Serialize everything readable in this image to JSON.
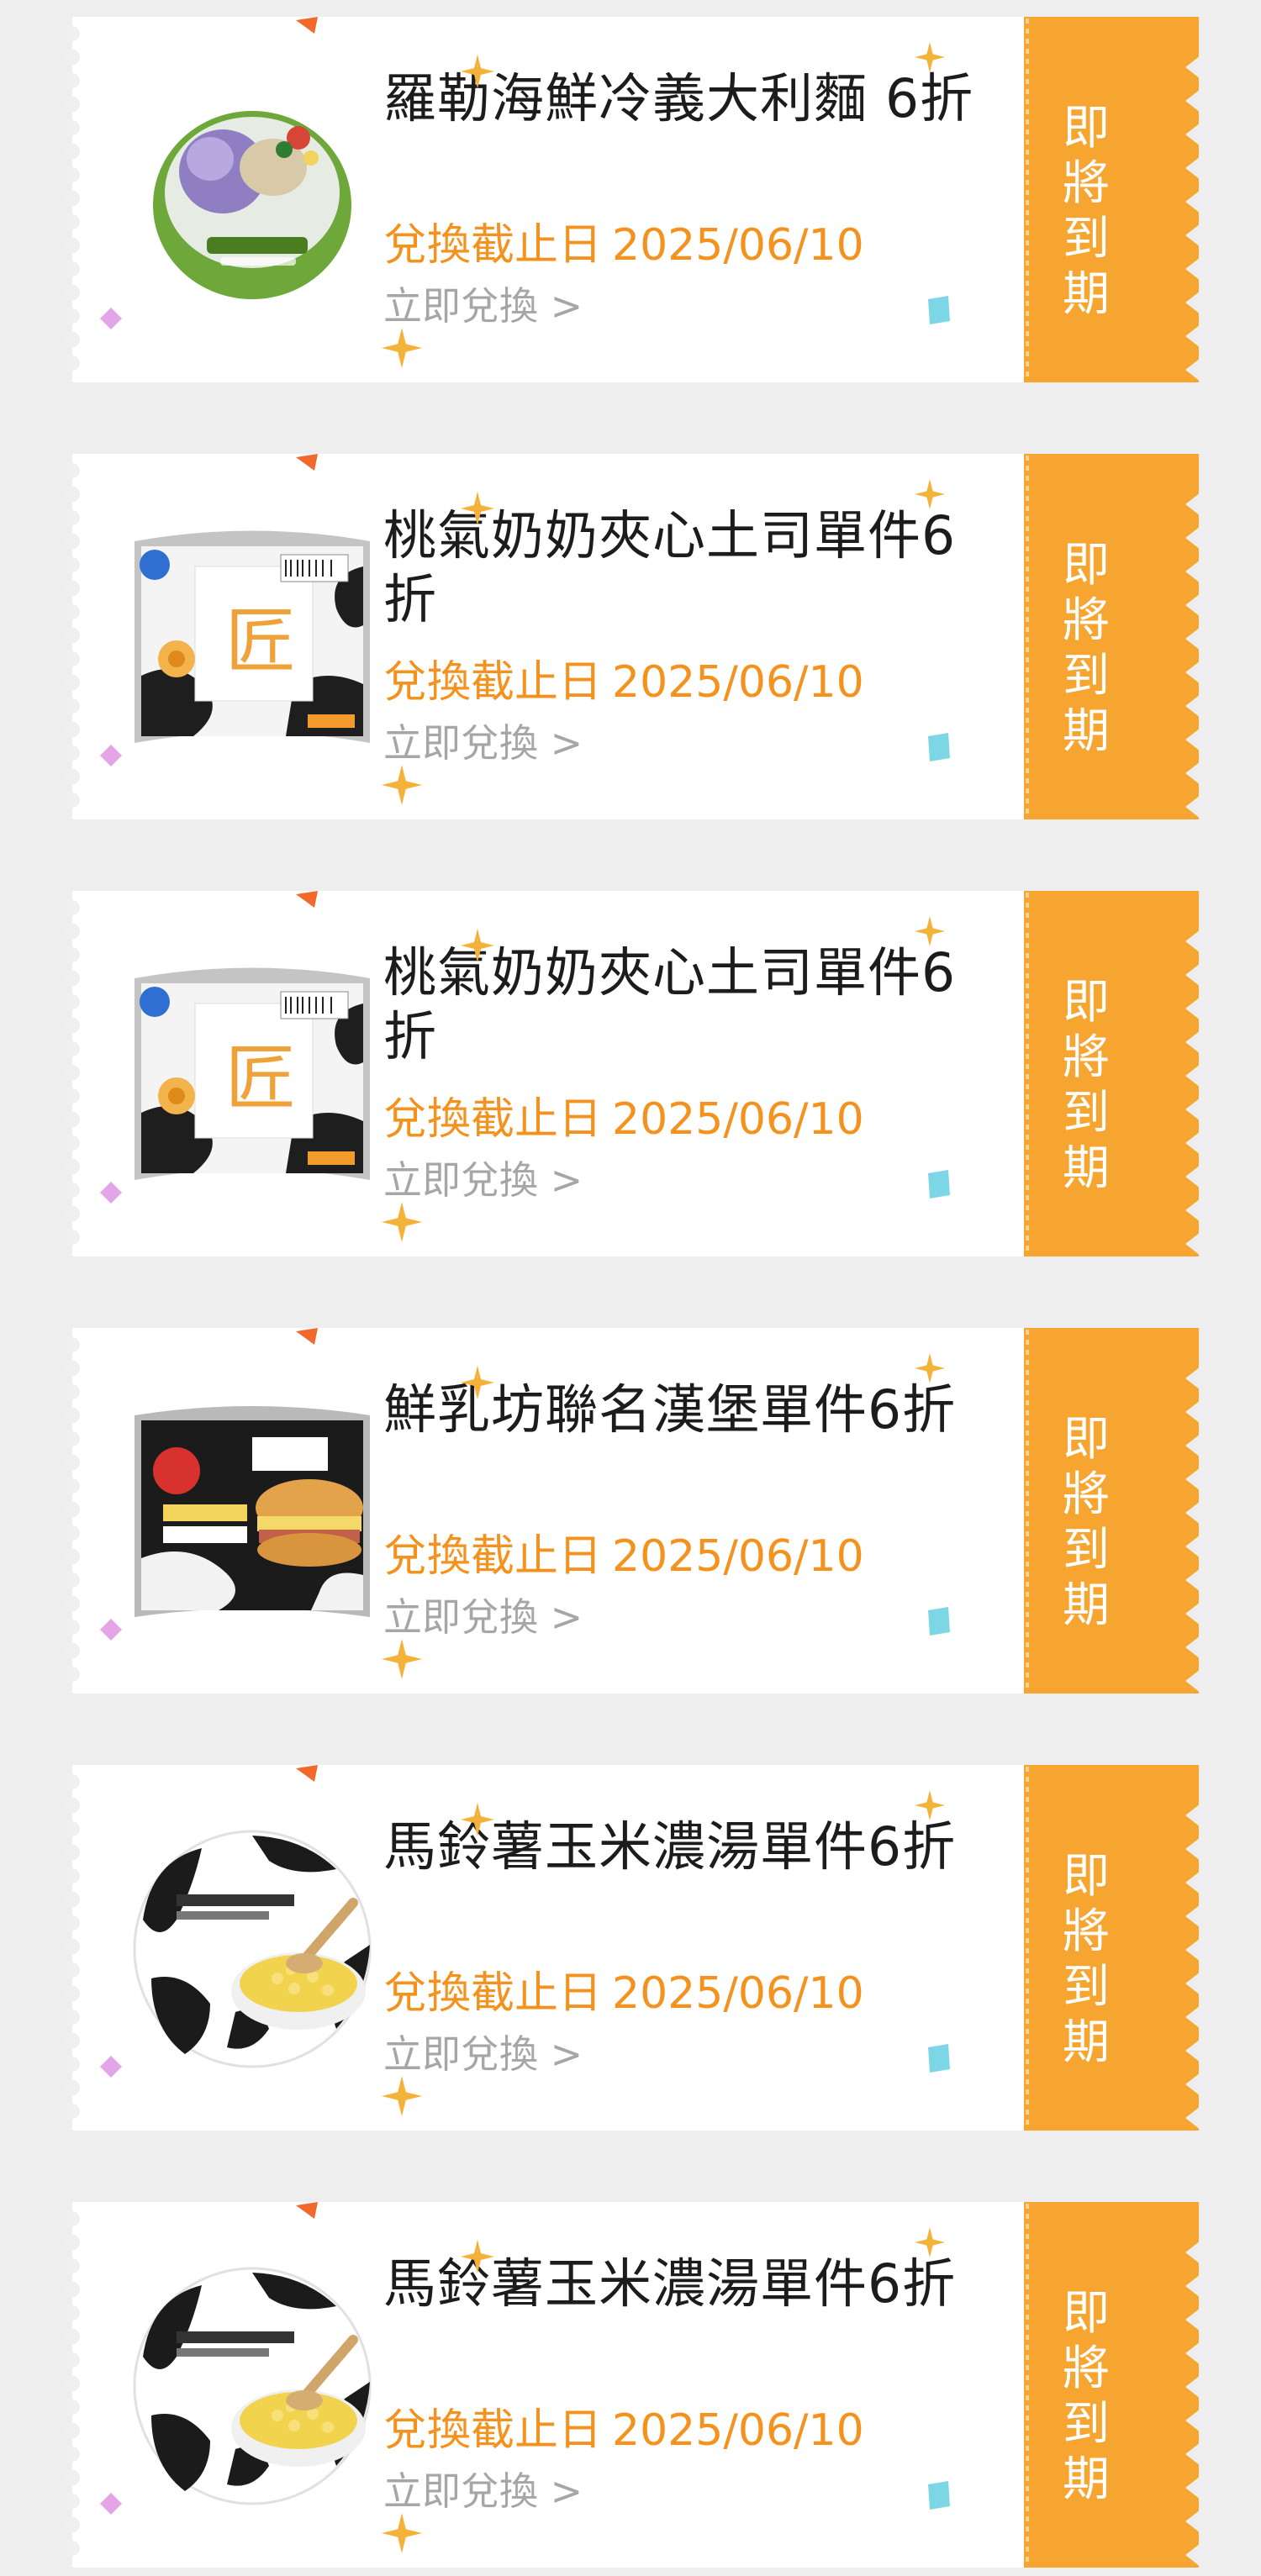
{
  "colors": {
    "accent_orange": "#f5921e",
    "stub_orange": "#f7a531",
    "muted_text": "#a6a6a6"
  },
  "coupons": [
    {
      "product_icon": "seafood-pasta-icon",
      "title": "羅勒海鮮冷義大利麵 6折",
      "deadline_label": "兌換截止日",
      "deadline_date": "2025/06/10",
      "redeem_label": "立即兌換 >",
      "status": [
        "即",
        "將",
        "到",
        "期"
      ]
    },
    {
      "product_icon": "toast-sandwich-icon",
      "title": "桃氣奶奶夾心土司單件6折",
      "deadline_label": "兌換截止日",
      "deadline_date": "2025/06/10",
      "redeem_label": "立即兌換 >",
      "status": [
        "即",
        "將",
        "到",
        "期"
      ]
    },
    {
      "product_icon": "toast-sandwich-icon",
      "title": "桃氣奶奶夾心土司單件6折",
      "deadline_label": "兌換截止日",
      "deadline_date": "2025/06/10",
      "redeem_label": "立即兌換 >",
      "status": [
        "即",
        "將",
        "到",
        "期"
      ]
    },
    {
      "product_icon": "burger-icon",
      "title": "鮮乳坊聯名漢堡單件6折",
      "deadline_label": "兌換截止日",
      "deadline_date": "2025/06/10",
      "redeem_label": "立即兌換 >",
      "status": [
        "即",
        "將",
        "到",
        "期"
      ]
    },
    {
      "product_icon": "corn-soup-icon",
      "title": "馬鈴薯玉米濃湯單件6折",
      "deadline_label": "兌換截止日",
      "deadline_date": "2025/06/10",
      "redeem_label": "立即兌換 >",
      "status": [
        "即",
        "將",
        "到",
        "期"
      ]
    },
    {
      "product_icon": "corn-soup-icon",
      "title": "馬鈴薯玉米濃湯單件6折",
      "deadline_label": "兌換截止日",
      "deadline_date": "2025/06/10",
      "redeem_label": "立即兌換 >",
      "status": [
        "即",
        "將",
        "到",
        "期"
      ]
    }
  ]
}
